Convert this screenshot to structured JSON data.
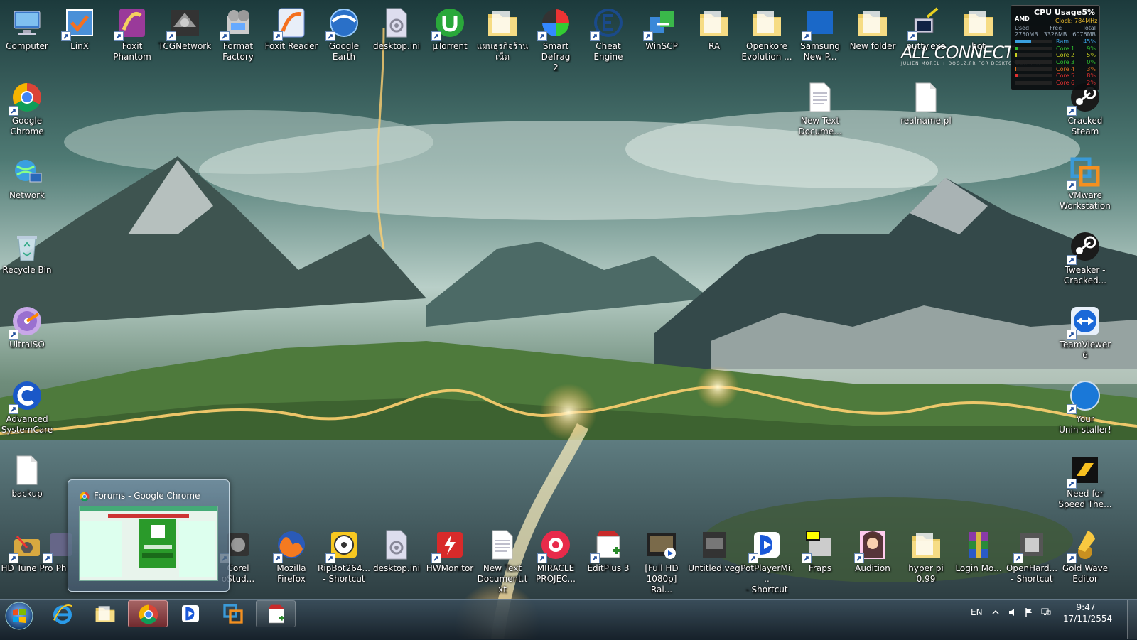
{
  "desktop": {
    "icons": [
      {
        "label": "Computer",
        "icon": "computer-icon",
        "shortcut": false
      },
      {
        "label": "LinX",
        "icon": "linx-icon",
        "shortcut": true
      },
      {
        "label": "Foxit\nPhantom",
        "icon": "foxit-phantom-icon",
        "shortcut": true
      },
      {
        "label": "TCGNetwork",
        "icon": "tcgnetwork-icon",
        "shortcut": true
      },
      {
        "label": "Format\nFactory",
        "icon": "format-factory-icon",
        "shortcut": true
      },
      {
        "label": "Foxit Reader",
        "icon": "foxit-reader-icon",
        "shortcut": true
      },
      {
        "label": "Google Earth",
        "icon": "google-earth-icon",
        "shortcut": true
      },
      {
        "label": "desktop.ini",
        "icon": "settings-file-icon",
        "shortcut": false
      },
      {
        "label": "µTorrent",
        "icon": "utorrent-icon",
        "shortcut": true
      },
      {
        "label": "แผนธุรกิจร้าน\nเน็ต",
        "icon": "folder-icon",
        "shortcut": false
      },
      {
        "label": "Smart Defrag\n2",
        "icon": "smart-defrag-icon",
        "shortcut": true
      },
      {
        "label": "Cheat Engine",
        "icon": "cheat-engine-icon",
        "shortcut": true
      },
      {
        "label": "WinSCP",
        "icon": "winscp-icon",
        "shortcut": true
      },
      {
        "label": "RA",
        "icon": "folder-icon",
        "shortcut": false
      },
      {
        "label": "Openkore\nEvolution ...",
        "icon": "folder-icon",
        "shortcut": false
      },
      {
        "label": "Samsung\nNew P...",
        "icon": "nps-icon",
        "shortcut": true
      },
      {
        "label": "New folder",
        "icon": "folder-icon",
        "shortcut": false
      },
      {
        "label": "putty.exe",
        "icon": "putty-icon",
        "shortcut": true
      },
      {
        "label": "bot",
        "icon": "folder-icon",
        "shortcut": false
      },
      {
        "label": "Google\nChrome",
        "icon": "chrome-icon",
        "shortcut": true
      },
      {
        "label": "Network",
        "icon": "network-icon",
        "shortcut": false
      },
      {
        "label": "Recycle Bin",
        "icon": "recycle-bin-icon",
        "shortcut": false
      },
      {
        "label": "UltraISO",
        "icon": "ultraiso-icon",
        "shortcut": true
      },
      {
        "label": "Advanced\nSystemCare",
        "icon": "advanced-systemcare-icon",
        "shortcut": true
      },
      {
        "label": "backup",
        "icon": "file-icon",
        "shortcut": false
      },
      {
        "label": "HD Tune Pro",
        "icon": "hd-tune-icon",
        "shortcut": true
      },
      {
        "label": "Ph",
        "icon": "generic-app-icon",
        "shortcut": true
      },
      {
        "label": "New Text\nDocume...",
        "icon": "text-file-icon",
        "shortcut": false
      },
      {
        "label": "realname.pl",
        "icon": "file-icon",
        "shortcut": false
      },
      {
        "label": "Cracked\nSteam",
        "icon": "steam-icon",
        "shortcut": true
      },
      {
        "label": "VMware\nWorkstation",
        "icon": "vmware-icon",
        "shortcut": true
      },
      {
        "label": "Tweaker -\nCracked...",
        "icon": "steam-icon",
        "shortcut": true
      },
      {
        "label": "TeamViewer\n6",
        "icon": "teamviewer-icon",
        "shortcut": true
      },
      {
        "label": "Your\nUnin-staller!",
        "icon": "your-uninstaller-icon",
        "shortcut": true
      },
      {
        "label": "Need for\nSpeed The...",
        "icon": "need-for-speed-icon",
        "shortcut": true
      },
      {
        "label": "Corel\noStud...",
        "icon": "corel-icon",
        "shortcut": true
      },
      {
        "label": "Mozilla\nFirefox",
        "icon": "firefox-icon",
        "shortcut": true
      },
      {
        "label": "RipBot264...\n- Shortcut",
        "icon": "ripbot-icon",
        "shortcut": true
      },
      {
        "label": "desktop.ini",
        "icon": "settings-file-icon",
        "shortcut": false
      },
      {
        "label": "HWMonitor",
        "icon": "hwmonitor-icon",
        "shortcut": true
      },
      {
        "label": "New Text\nDocument.txt",
        "icon": "text-file-icon",
        "shortcut": false
      },
      {
        "label": "MIRACLE\nPROJEC...",
        "icon": "miracle-icon",
        "shortcut": true
      },
      {
        "label": "EditPlus 3",
        "icon": "editplus-icon",
        "shortcut": true
      },
      {
        "label": "[Full HD\n1080p] Rai...",
        "icon": "video-file-icon",
        "shortcut": false
      },
      {
        "label": "Untitled.veg",
        "icon": "vegas-file-icon",
        "shortcut": false
      },
      {
        "label": "PotPlayerMi...\n- Shortcut",
        "icon": "potplayer-icon",
        "shortcut": true
      },
      {
        "label": "Fraps",
        "icon": "fraps-icon",
        "shortcut": true
      },
      {
        "label": "Audition",
        "icon": "audition-icon",
        "shortcut": true
      },
      {
        "label": "hyper pi 0.99",
        "icon": "folder-icon",
        "shortcut": false
      },
      {
        "label": "Login Mo...",
        "icon": "winrar-icon",
        "shortcut": false
      },
      {
        "label": "OpenHard...\n- Shortcut",
        "icon": "openhardware-icon",
        "shortcut": true
      },
      {
        "label": "Gold Wave\nEditor",
        "icon": "goldwave-icon",
        "shortcut": true
      }
    ]
  },
  "gadget": {
    "title": "CPU Usage",
    "percent": "5%",
    "brand": "AMD",
    "clock": "Clock: 784MHz",
    "mem_headers": [
      "Used",
      "Free",
      "Total"
    ],
    "mem_values": [
      "2750MB",
      "3326MB",
      "6076MB"
    ],
    "rows": [
      {
        "label": "Ram",
        "value": "45%",
        "fraction": 0.45,
        "color": "#3aa0e0"
      },
      {
        "label": "Core 1",
        "value": "9%",
        "fraction": 0.09,
        "color": "#30c030"
      },
      {
        "label": "Core 2",
        "value": "5%",
        "fraction": 0.05,
        "color": "#c8d020"
      },
      {
        "label": "Core 3",
        "value": "0%",
        "fraction": 0.0,
        "color": "#30c030"
      },
      {
        "label": "Core 4",
        "value": "3%",
        "fraction": 0.03,
        "color": "#e07020"
      },
      {
        "label": "Core 5",
        "value": "8%",
        "fraction": 0.08,
        "color": "#e03030"
      },
      {
        "label": "Core 6",
        "value": "2%",
        "fraction": 0.02,
        "color": "#e03030"
      }
    ]
  },
  "wallpaper": {
    "brand": "ALL CONNECT",
    "brand_sub": "JULIEN MOREL + DOOLZ.FR FOR DESKTOPOGRAPHY"
  },
  "thumbnail": {
    "title": "Forums - Google Chrome"
  },
  "taskbar": {
    "buttons": [
      {
        "name": "internet-explorer",
        "icon": "internet-explorer-icon",
        "state": "pinned-plain"
      },
      {
        "name": "windows-explorer",
        "icon": "folder-icon",
        "state": "pinned-plain"
      },
      {
        "name": "google-chrome",
        "icon": "chrome-icon",
        "state": "active"
      },
      {
        "name": "potplayer",
        "icon": "potplayer-icon",
        "state": "pinned-plain"
      },
      {
        "name": "vmware",
        "icon": "vmware-icon",
        "state": "pinned-plain"
      },
      {
        "name": "editplus",
        "icon": "editplus-icon",
        "state": "pinned"
      }
    ],
    "language": "EN",
    "time": "9:47",
    "date": "17/11/2554"
  }
}
